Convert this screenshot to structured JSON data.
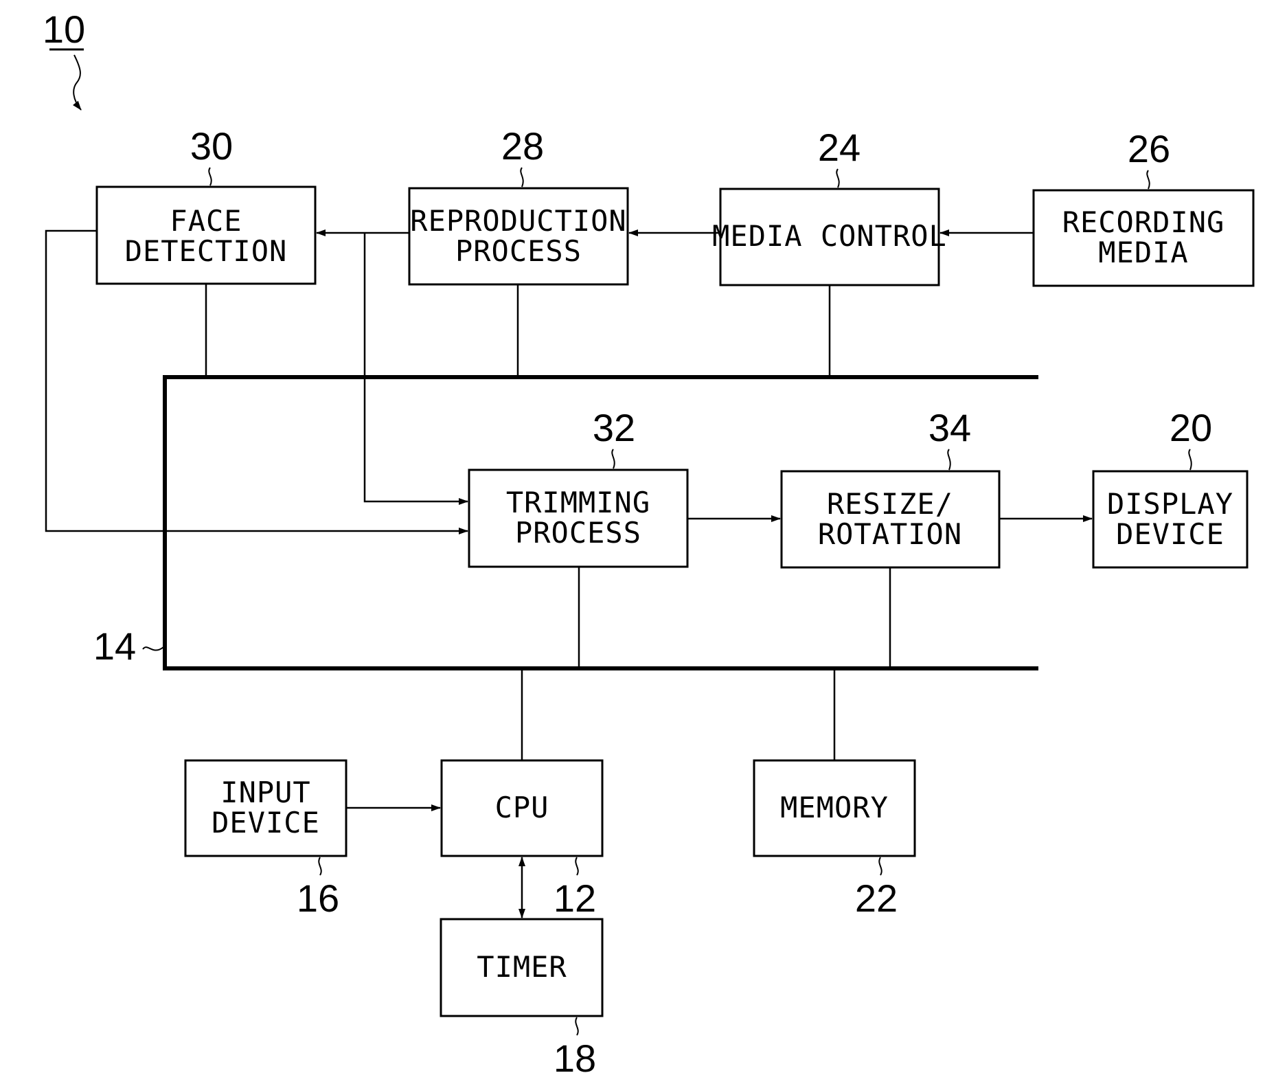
{
  "figure": {
    "ref": "10",
    "bus_ref": "14"
  },
  "blocks": {
    "face_detection": {
      "ref": "30",
      "lines": [
        "FACE",
        "DETECTION"
      ]
    },
    "reproduction": {
      "ref": "28",
      "lines": [
        "REPRODUCTION",
        "PROCESS"
      ]
    },
    "media_control": {
      "ref": "24",
      "lines": [
        "MEDIA CONTROL"
      ]
    },
    "recording_media": {
      "ref": "26",
      "lines": [
        "RECORDING",
        "MEDIA"
      ]
    },
    "trimming": {
      "ref": "32",
      "lines": [
        "TRIMMING",
        "PROCESS"
      ]
    },
    "resize": {
      "ref": "34",
      "lines": [
        "RESIZE/",
        "ROTATION"
      ]
    },
    "display": {
      "ref": "20",
      "lines": [
        "DISPLAY",
        "DEVICE"
      ]
    },
    "input": {
      "ref": "16",
      "lines": [
        "INPUT",
        "DEVICE"
      ]
    },
    "cpu": {
      "ref": "12",
      "lines": [
        "CPU"
      ]
    },
    "memory": {
      "ref": "22",
      "lines": [
        "MEMORY"
      ]
    },
    "timer": {
      "ref": "18",
      "lines": [
        "TIMER"
      ]
    }
  },
  "connections": [
    {
      "from": "recording_media",
      "to": "media_control",
      "type": "arrow"
    },
    {
      "from": "media_control",
      "to": "reproduction",
      "type": "arrow"
    },
    {
      "from": "reproduction",
      "to": "face_detection",
      "type": "arrow"
    },
    {
      "from": "reproduction",
      "to": "trimming",
      "type": "arrow"
    },
    {
      "from": "face_detection",
      "to": "trimming",
      "type": "arrow"
    },
    {
      "from": "trimming",
      "to": "resize",
      "type": "arrow"
    },
    {
      "from": "resize",
      "to": "display",
      "type": "arrow"
    },
    {
      "from": "input",
      "to": "cpu",
      "type": "arrow"
    },
    {
      "from": "cpu",
      "to": "timer",
      "type": "bidirectional"
    },
    {
      "from": "face_detection",
      "to": "bus",
      "type": "line"
    },
    {
      "from": "reproduction",
      "to": "bus",
      "type": "line"
    },
    {
      "from": "media_control",
      "to": "bus",
      "type": "line"
    },
    {
      "from": "trimming",
      "to": "bus",
      "type": "line"
    },
    {
      "from": "resize",
      "to": "bus",
      "type": "line"
    },
    {
      "from": "cpu",
      "to": "bus",
      "type": "line"
    },
    {
      "from": "memory",
      "to": "bus",
      "type": "line"
    }
  ]
}
